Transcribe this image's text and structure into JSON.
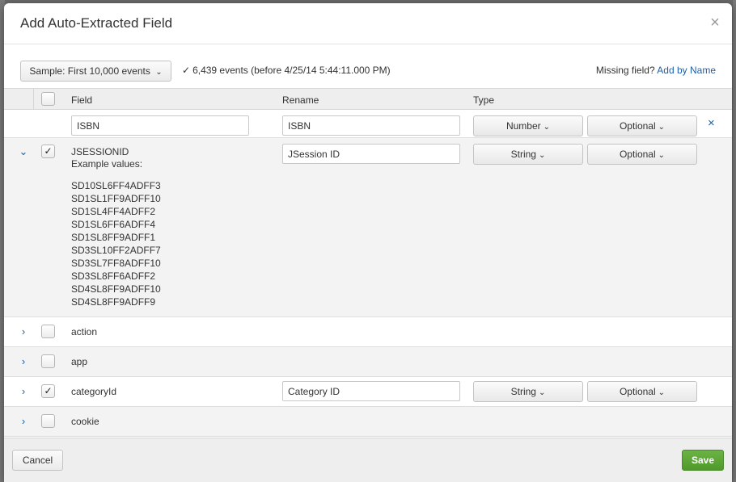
{
  "modal": {
    "title": "Add Auto-Extracted Field",
    "close_glyph": "×"
  },
  "toolbar": {
    "sample_label": "Sample: First 10,000 events",
    "status_check": "✓",
    "events_status": "6,439 events (before 4/25/14 5:44:11.000 PM)",
    "missing_label": "Missing field?",
    "add_by_name_link": "Add by Name"
  },
  "table": {
    "headers": {
      "field": "Field",
      "rename": "Rename",
      "type": "Type"
    },
    "new_field_row": {
      "field_value": "ISBN",
      "rename_value": "ISBN",
      "type": "Number",
      "requirement": "Optional",
      "remove_glyph": "×"
    },
    "rows": [
      {
        "name": "JSESSIONID",
        "expanded": true,
        "checked": true,
        "rename": "JSession ID",
        "type": "String",
        "requirement": "Optional",
        "example_label": "Example values:",
        "examples": [
          "SD10SL6FF4ADFF3",
          "SD1SL1FF9ADFF10",
          "SD1SL4FF4ADFF2",
          "SD1SL6FF6ADFF4",
          "SD1SL8FF9ADFF1",
          "SD3SL10FF2ADFF7",
          "SD3SL7FF8ADFF10",
          "SD3SL8FF6ADFF2",
          "SD4SL8FF9ADFF10",
          "SD4SL8FF9ADFF9"
        ]
      },
      {
        "name": "action",
        "checked": false
      },
      {
        "name": "app",
        "checked": false
      },
      {
        "name": "categoryId",
        "checked": true,
        "rename": "Category ID",
        "type": "String",
        "requirement": "Optional"
      },
      {
        "name": "cookie",
        "checked": false
      }
    ]
  },
  "glyphs": {
    "check": "✓",
    "caret": "⌄",
    "chevron_right": "›",
    "chevron_down": "⌄"
  },
  "footer": {
    "cancel_label": "Cancel",
    "save_label": "Save"
  },
  "colors": {
    "link": "#1e5fa8",
    "save": "#5aa532"
  }
}
